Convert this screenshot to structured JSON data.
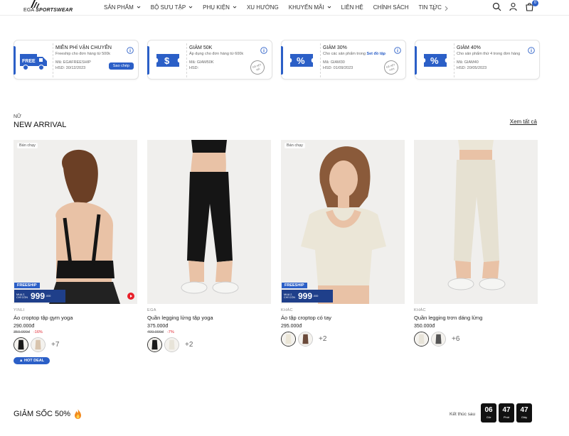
{
  "brand": {
    "logo_text_prefix": "EGA",
    "logo_text_main": "SPORTSWEAR"
  },
  "nav": [
    {
      "label": "SẢN PHẨM",
      "dropdown": true
    },
    {
      "label": "BỘ SƯU TẬP",
      "dropdown": true
    },
    {
      "label": "PHỤ KIỆN",
      "dropdown": true
    },
    {
      "label": "XU HƯỚNG",
      "dropdown": false
    },
    {
      "label": "KHUYẾN MÃI",
      "dropdown": true
    },
    {
      "label": "LIÊN HỆ",
      "dropdown": false
    },
    {
      "label": "CHÍNH SÁCH",
      "dropdown": false
    },
    {
      "label": "TIN TỨC",
      "dropdown": false
    }
  ],
  "header_icons": [
    "search-icon",
    "user-icon",
    "cart-icon"
  ],
  "cart": {
    "count": "0"
  },
  "coupons": [
    {
      "icon": "free-truck-icon",
      "title": "MIỄN PHÍ VẬN CHUYỂN",
      "desc": "Freeship cho đơn hàng từ 500k",
      "desc_link": "",
      "code": "Mã: EGAFREESHIP",
      "expiry": "HSD: 30/12/2023",
      "action": "Sao chép",
      "stamp": ""
    },
    {
      "icon": "dollar-ticket-icon",
      "title": "GIẢM 50K",
      "desc": "Áp dụng cho đơn hàng từ 600k",
      "desc_link": "",
      "code": "Mã: GIAM50K",
      "expiry": "HSD:",
      "action": "",
      "stamp": "ĐÃ HẾT MÃ"
    },
    {
      "icon": "percent-ticket-icon",
      "title": "GIẢM 30%",
      "desc": "Cho các sản phẩm trong ",
      "desc_link": "Set đồ tập",
      "code": "Mã: GIAM30",
      "expiry": "HSD: 01/09/2023",
      "action": "",
      "stamp": "ĐÃ HẾT HẠN"
    },
    {
      "icon": "percent-ticket-icon",
      "title": "GIẢM 40%",
      "desc": "Cho sản phẩm thứ 4 trong đơn hàng",
      "desc_link": "",
      "code": "Mã: GIAM40",
      "expiry": "HSD: 20/05/2023",
      "action": "",
      "stamp": ""
    }
  ],
  "section": {
    "small": "NỮ",
    "title": "NEW ARRIVAL",
    "see_all": "Xem tất cả"
  },
  "promo": {
    "freeship": "FREESHIP",
    "buy_label": "MUA 2 CHỈ CÒN",
    "price": "999",
    "price_tail": ".000",
    "tail_note": "đ TỪ 2 SP CHOICE"
  },
  "products": [
    {
      "badge": "Bán chạy",
      "promo": true,
      "video": true,
      "brand": "YINLI",
      "name": "Áo croptop tập gym yoga",
      "price": "290.000đ",
      "old_price": "350.000đ",
      "discount": "-16%",
      "more": "+7",
      "hot": "HOT DEAL",
      "image": "woman-back-black-sports-bra"
    },
    {
      "badge": "",
      "promo": false,
      "video": false,
      "brand": "EGA",
      "name": "Quần legging lửng tập yoga",
      "price": "375.000đ",
      "old_price": "400.000đ",
      "discount": "-7%",
      "more": "+2",
      "hot": "",
      "image": "black-capri-leggings"
    },
    {
      "badge": "Bán chạy",
      "promo": true,
      "video": false,
      "brand": "KHÁC",
      "name": "Áo tập croptop có tay",
      "price": "295.000đ",
      "old_price": "",
      "discount": "",
      "more": "+2",
      "hot": "",
      "image": "cream-short-sleeve-crop-top"
    },
    {
      "badge": "",
      "promo": false,
      "video": false,
      "brand": "KHÁC",
      "name": "Quần legging trơn dáng lửng",
      "price": "350.000đ",
      "old_price": "",
      "discount": "",
      "more": "+6",
      "hot": "",
      "image": "cream-capri-leggings"
    }
  ],
  "flash": {
    "title": "GIẢM SỐC 50%",
    "ends_label": "Kết thúc sau",
    "timer": [
      {
        "n": "06",
        "u": "Giờ"
      },
      {
        "n": "47",
        "u": "Phút"
      },
      {
        "n": "47",
        "u": "Giây"
      }
    ]
  },
  "colors": {
    "accent": "#2b5fc7",
    "dark_blue": "#1f3f8a",
    "sale_red": "#e0242f"
  }
}
